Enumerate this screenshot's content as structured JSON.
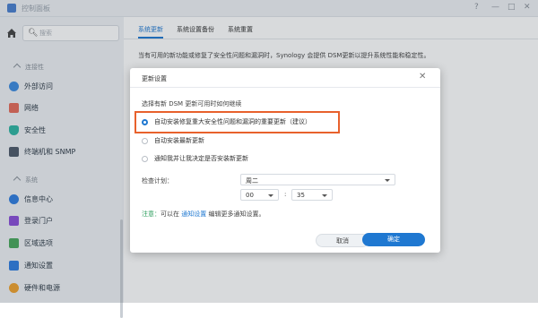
{
  "window": {
    "title": "控制面板",
    "help": "?",
    "minimize": "—",
    "maximize": "□",
    "close": "✕"
  },
  "sidebar": {
    "search_placeholder": "搜索",
    "sections": [
      {
        "label": "连接性",
        "items": [
          "外部访问",
          "网络",
          "安全性",
          "终端机和 SNMP"
        ]
      },
      {
        "label": "系统",
        "items": [
          "信息中心",
          "登录门户",
          "区域选项",
          "通知设置",
          "硬件和电源"
        ]
      }
    ]
  },
  "tabs": [
    "系统更新",
    "系统设置备份",
    "系统重置"
  ],
  "description": "当有可用的新功能或修复了安全性问题和漏洞时，Synology 会提供 DSM更新以提升系统性能和稳定性。",
  "dialog": {
    "title": "更新设置",
    "prompt": "选择有新 DSM 更新可用时如何继续",
    "options": [
      "自动安装修复重大安全性问题和漏洞的重要更新（建议）",
      "自动安装最新更新",
      "通知我并让我决定是否安装新更新"
    ],
    "schedule_label": "检查计划：",
    "day_value": "周二",
    "hour_value": "00",
    "minute_value": "35",
    "time_sep": ":",
    "note_prefix": "注意：",
    "note_text1": "可以在",
    "note_link": "通知设置",
    "note_text2": "编辑更多通知设置。",
    "cancel_label": "取消",
    "ok_label": "确定"
  },
  "colors": {
    "accent": "#1f78d1",
    "highlight": "#e8612c"
  }
}
